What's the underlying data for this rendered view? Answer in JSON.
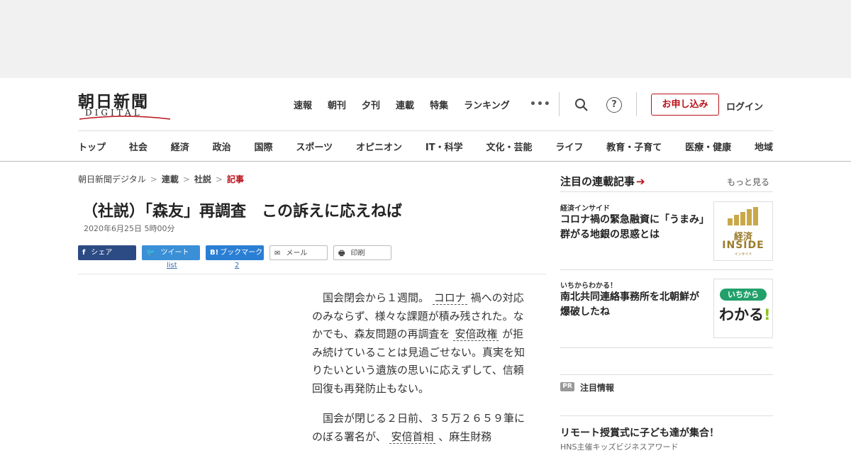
{
  "header": {
    "logo_main": "朝日新聞",
    "logo_sub": "DIGITAL",
    "top_nav": [
      "速報",
      "朝刊",
      "夕刊",
      "連載",
      "特集",
      "ランキング"
    ],
    "more_label": "•••",
    "help_label": "?",
    "apply_label": "お申し込み",
    "login_label": "ログイン",
    "categories": [
      "トップ",
      "社会",
      "経済",
      "政治",
      "国際",
      "スポーツ",
      "オピニオン",
      "IT・科学",
      "文化・芸能",
      "ライフ",
      "教育・子育て",
      "医療・健康",
      "地域"
    ]
  },
  "breadcrumb": {
    "items": [
      "朝日新聞デジタル",
      "連載",
      "社説"
    ],
    "current": "記事",
    "separator": ">"
  },
  "article": {
    "title": "（社説）「森友」再調査　この訴えに応えねば",
    "date": "2020年6月25日 5時00分",
    "p1": {
      "t1": "国会閉会から１週間。",
      "k1": "コロナ",
      "t2": "禍への対応のみならず、様々な課題が積み残された。なかでも、森友問題の再調査を",
      "k2": "安倍政権",
      "t3": "が拒み続けていることは見過ごせない。真実を知りたいという遺族の思いに応えずして、信頼回復も再発防止もない。"
    },
    "p2": {
      "t1": "国会が閉じる２日前、３５万２６５９筆にのぼる署名が、",
      "k1": "安倍首相",
      "t2": "、麻生財務"
    }
  },
  "share": {
    "facebook": "シェア",
    "twitter": "ツイート",
    "hatena": "ブックマーク",
    "mail": "メール",
    "print": "印刷",
    "twitter_count": "list",
    "hatena_count": "2",
    "colors": {
      "facebook": "#2c4a84",
      "twitter": "#3a8fd6",
      "hatena": "#2a7fd4"
    }
  },
  "sidebar": {
    "heading": "注目の連載記事",
    "more": "もっと見る",
    "items": [
      {
        "tag": "経済インサイド",
        "title": "コロナ禍の緊急融資に「うまみ」　群がる地銀の思惑とは",
        "thumb_line1": "経済",
        "thumb_line2": "INSIDE",
        "thumb_line3": "インサイド"
      },
      {
        "tag": "いちからわかる！",
        "title": "南北共同連絡事務所を北朝鮮が爆破したね",
        "thumb_line1": "いちから",
        "thumb_line2": "わかる",
        "thumb_bang": "!"
      }
    ],
    "pr_badge": "PR",
    "pr_label": "注目情報",
    "pr_title": "リモート授賞式に子ども達が集合！",
    "pr_sub": "HNS主催キッズビジネスアワード"
  },
  "colors": {
    "accent": "#b9121b"
  }
}
